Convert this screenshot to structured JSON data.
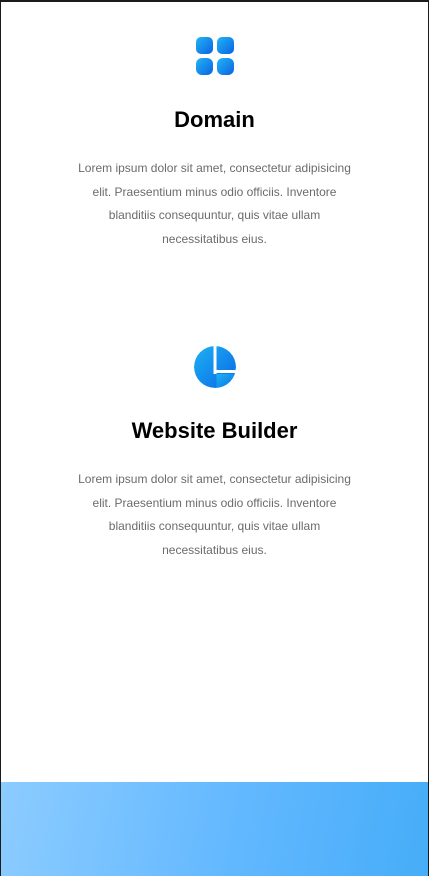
{
  "features": [
    {
      "icon": "grid-apps-icon",
      "title": "Domain",
      "description": "Lorem ipsum dolor sit amet, consectetur adipisicing elit. Praesentium minus odio officiis. Inventore blanditiis consequuntur, quis vitae ullam necessitatibus eius."
    },
    {
      "icon": "pie-layout-icon",
      "title": "Website Builder",
      "description": "Lorem ipsum dolor sit amet, consectetur adipisicing elit. Praesentium minus odio officiis. Inventore blanditiis consequuntur, quis vitae ullam necessitatibus eius."
    }
  ],
  "colors": {
    "icon_gradient_start": "#1ea7f2",
    "icon_gradient_end": "#0866e6",
    "title": "#000000",
    "body_text": "#6b6b6b",
    "footer_start": "#8cccff",
    "footer_end": "#46adf8"
  }
}
